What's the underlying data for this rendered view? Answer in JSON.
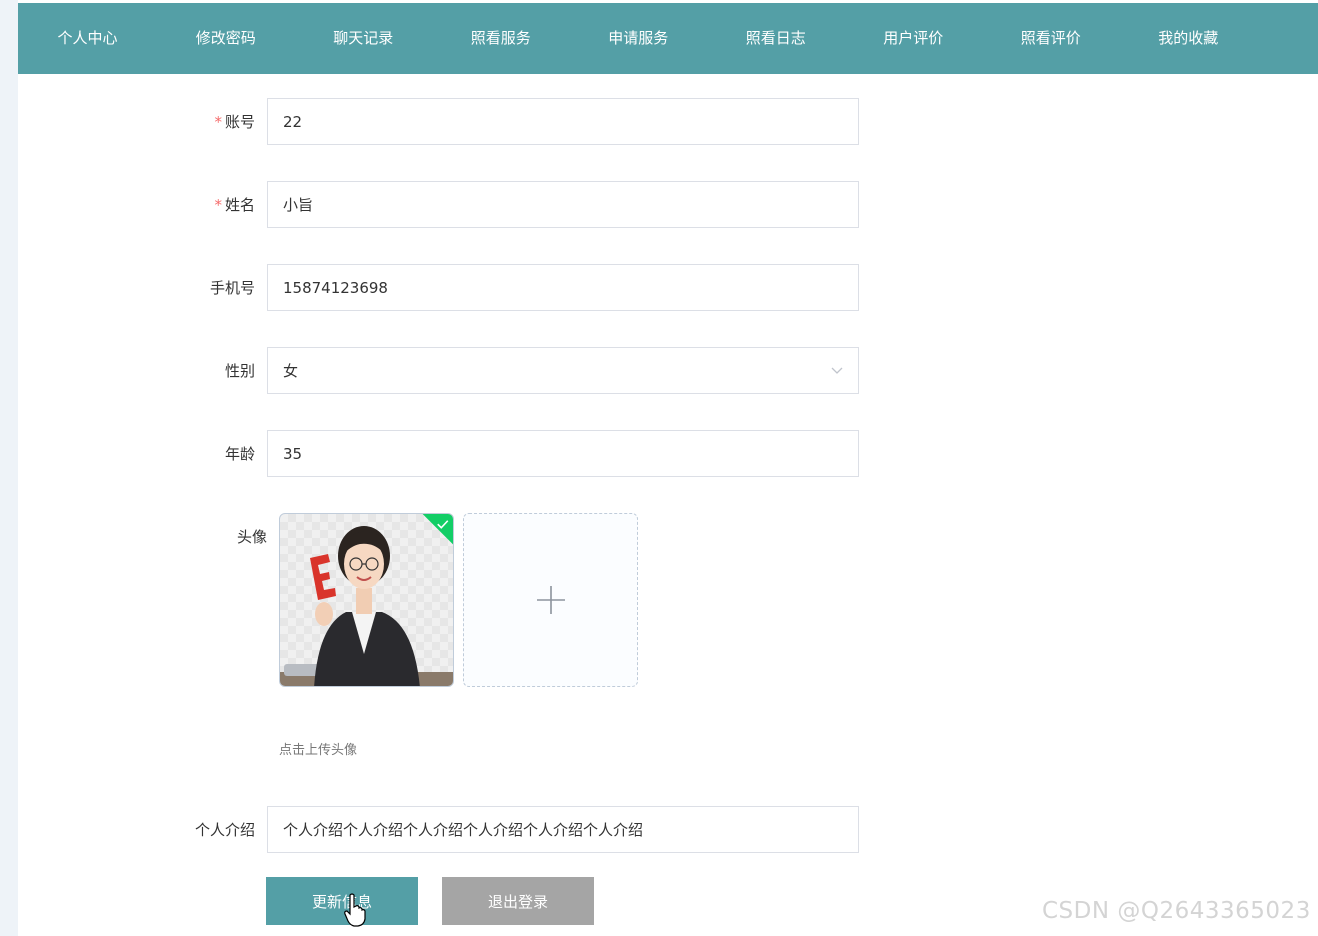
{
  "nav": {
    "items": [
      "个人中心",
      "修改密码",
      "聊天记录",
      "照看服务",
      "申请服务",
      "照看日志",
      "用户评价",
      "照看评价",
      "我的收藏"
    ]
  },
  "form": {
    "account": {
      "label": "账号",
      "value": "22",
      "required": true
    },
    "name": {
      "label": "姓名",
      "value": "小旨",
      "required": true
    },
    "phone": {
      "label": "手机号",
      "value": "15874123698"
    },
    "gender": {
      "label": "性别",
      "value": "女"
    },
    "age": {
      "label": "年龄",
      "value": "35"
    },
    "avatar": {
      "label": "头像",
      "tip": "点击上传头像"
    },
    "intro": {
      "label": "个人介绍",
      "value": "个人介绍个人介绍个人介绍个人介绍个人介绍个人介绍"
    }
  },
  "buttons": {
    "update": "更新信息",
    "logout": "退出登录"
  },
  "watermark": "CSDN @Q2643365023",
  "colors": {
    "primary": "#549fa6",
    "secondary_button": "#a5a5a5",
    "required_star": "#f56c6c",
    "success": "#13ce66"
  },
  "icons": {
    "select_arrow": "chevron-down-icon",
    "upload": "plus-icon",
    "uploaded": "check-icon",
    "pointer": "hand-cursor-icon"
  }
}
